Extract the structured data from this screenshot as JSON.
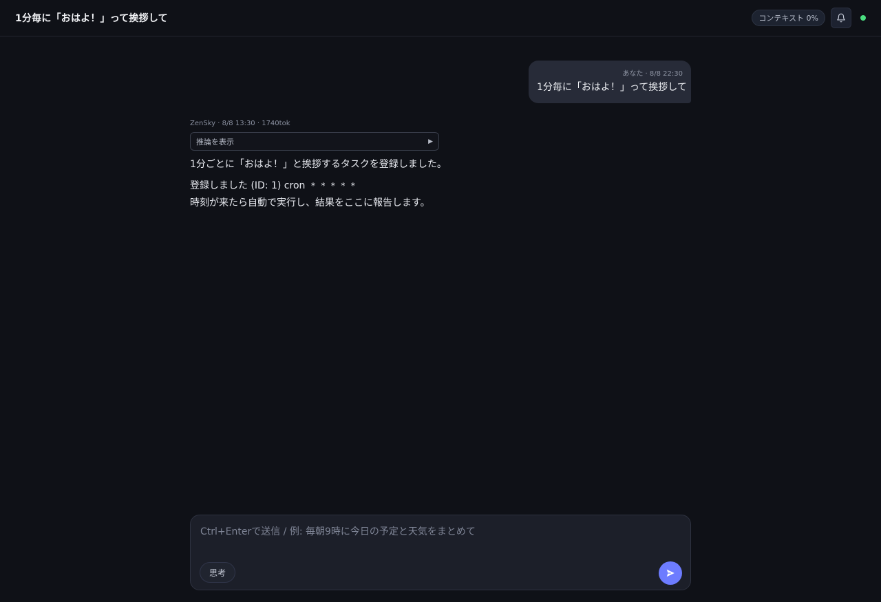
{
  "header": {
    "title": "1分毎に「おはよ！」って挨拶して",
    "context_label": "コンテキスト 0%",
    "bell_icon": "bell-icon",
    "status_color": "#4ade80"
  },
  "messages": {
    "user": {
      "meta": "あなた · 8/8 22:30",
      "text": "1分毎に「おはよ！」って挨拶して"
    },
    "assistant": {
      "meta": "ZenSky · 8/8 13:30 · 1740tok",
      "reasoning_label": "推論を表示",
      "line1": "1分ごとに「おはよ！」と挨拶するタスクを登録しました。",
      "line2_prefix": "登録しました (ID: 1) cron",
      "line2_code": "* * * * *",
      "line3": "時刻が来たら自動で実行し、結果をここに報告します。"
    }
  },
  "composer": {
    "placeholder": "Ctrl+Enterで送信 / 例: 毎朝9時に今日の予定と天気をまとめて",
    "value": "",
    "think_label": "思考",
    "send_icon": "send-icon",
    "accent": "#6d7cff"
  }
}
